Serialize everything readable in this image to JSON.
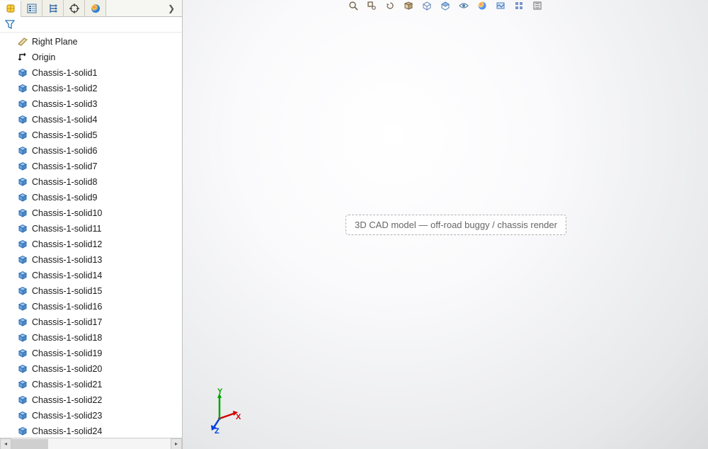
{
  "tabs": {
    "expand_glyph": "❯"
  },
  "triad": {
    "x": "X",
    "y": "Y",
    "z": "Z"
  },
  "tree": [
    {
      "icon": "plane",
      "label": "Right Plane"
    },
    {
      "icon": "origin",
      "label": "Origin"
    },
    {
      "icon": "solid",
      "label": "Chassis-1-solid1"
    },
    {
      "icon": "solid",
      "label": "Chassis-1-solid2"
    },
    {
      "icon": "solid",
      "label": "Chassis-1-solid3"
    },
    {
      "icon": "solid",
      "label": "Chassis-1-solid4"
    },
    {
      "icon": "solid",
      "label": "Chassis-1-solid5"
    },
    {
      "icon": "solid",
      "label": "Chassis-1-solid6"
    },
    {
      "icon": "solid",
      "label": "Chassis-1-solid7"
    },
    {
      "icon": "solid",
      "label": "Chassis-1-solid8"
    },
    {
      "icon": "solid",
      "label": "Chassis-1-solid9"
    },
    {
      "icon": "solid",
      "label": "Chassis-1-solid10"
    },
    {
      "icon": "solid",
      "label": "Chassis-1-solid11"
    },
    {
      "icon": "solid",
      "label": "Chassis-1-solid12"
    },
    {
      "icon": "solid",
      "label": "Chassis-1-solid13"
    },
    {
      "icon": "solid",
      "label": "Chassis-1-solid14"
    },
    {
      "icon": "solid",
      "label": "Chassis-1-solid15"
    },
    {
      "icon": "solid",
      "label": "Chassis-1-solid16"
    },
    {
      "icon": "solid",
      "label": "Chassis-1-solid17"
    },
    {
      "icon": "solid",
      "label": "Chassis-1-solid18"
    },
    {
      "icon": "solid",
      "label": "Chassis-1-solid19"
    },
    {
      "icon": "solid",
      "label": "Chassis-1-solid20"
    },
    {
      "icon": "solid",
      "label": "Chassis-1-solid21"
    },
    {
      "icon": "solid",
      "label": "Chassis-1-solid22"
    },
    {
      "icon": "solid",
      "label": "Chassis-1-solid23"
    },
    {
      "icon": "solid",
      "label": "Chassis-1-solid24"
    }
  ],
  "viewport": {
    "model_description": "3D CAD model — off-road buggy / chassis render"
  }
}
